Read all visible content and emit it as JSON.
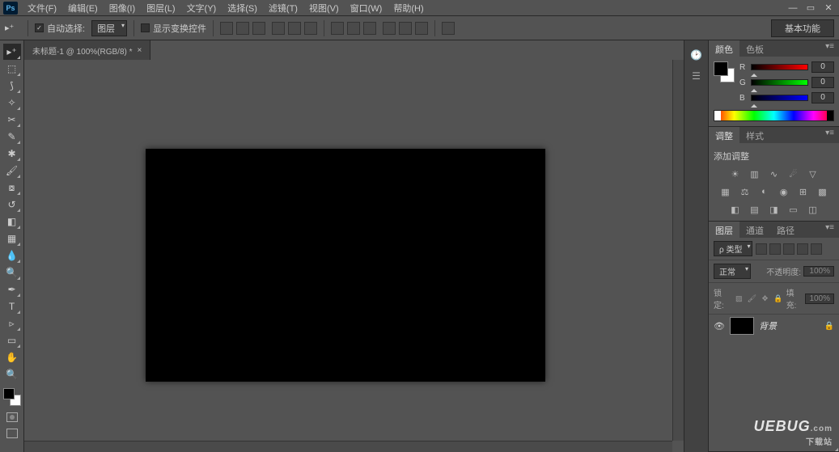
{
  "app": {
    "logo": "Ps"
  },
  "menu": {
    "file": "文件(F)",
    "edit": "编辑(E)",
    "image": "图像(I)",
    "layer": "图层(L)",
    "type": "文字(Y)",
    "select": "选择(S)",
    "filter": "滤镜(T)",
    "view": "视图(V)",
    "window": "窗口(W)",
    "help": "帮助(H)"
  },
  "options": {
    "auto_select": "自动选择:",
    "auto_select_checked": "✓",
    "target": "图层",
    "show_transform": "显示变换控件",
    "workspace": "基本功能"
  },
  "document": {
    "tab_title": "未标题-1 @ 100%(RGB/8) *"
  },
  "color_panel": {
    "tab_color": "颜色",
    "tab_swatches": "色板",
    "r_label": "R",
    "r_value": "0",
    "g_label": "G",
    "g_value": "0",
    "b_label": "B",
    "b_value": "0"
  },
  "adjustments_panel": {
    "tab_adjustments": "调整",
    "tab_styles": "样式",
    "title": "添加调整"
  },
  "layers_panel": {
    "tab_layers": "图层",
    "tab_channels": "通道",
    "tab_paths": "路径",
    "filter_label": "ρ 类型",
    "blend_mode": "正常",
    "opacity_label": "不透明度:",
    "opacity_value": "100%",
    "lock_label": "锁定:",
    "fill_label": "填充:",
    "fill_value": "100%",
    "layer_name": "背景"
  },
  "watermark": {
    "brand": "UEBUG",
    "suffix": ".com",
    "tag": "下载站"
  }
}
